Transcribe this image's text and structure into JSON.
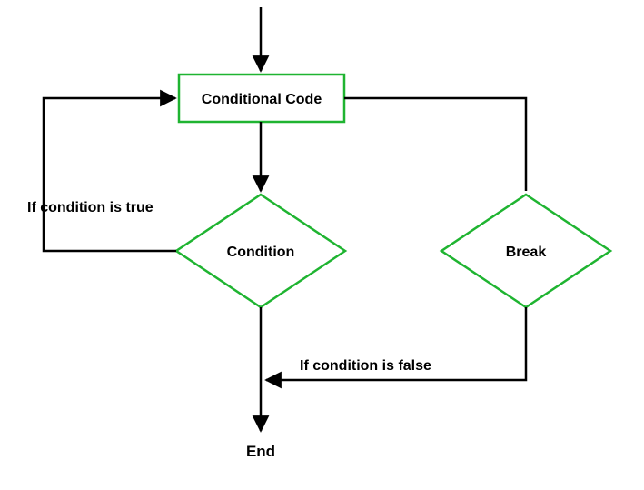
{
  "nodes": {
    "conditional_code": "Conditional Code",
    "condition": "Condition",
    "break": "Break",
    "end": "End"
  },
  "labels": {
    "true": "If condition is true",
    "false": "If condition is false"
  },
  "colors": {
    "shape_stroke": "#1fb431",
    "line_stroke": "#000000"
  }
}
